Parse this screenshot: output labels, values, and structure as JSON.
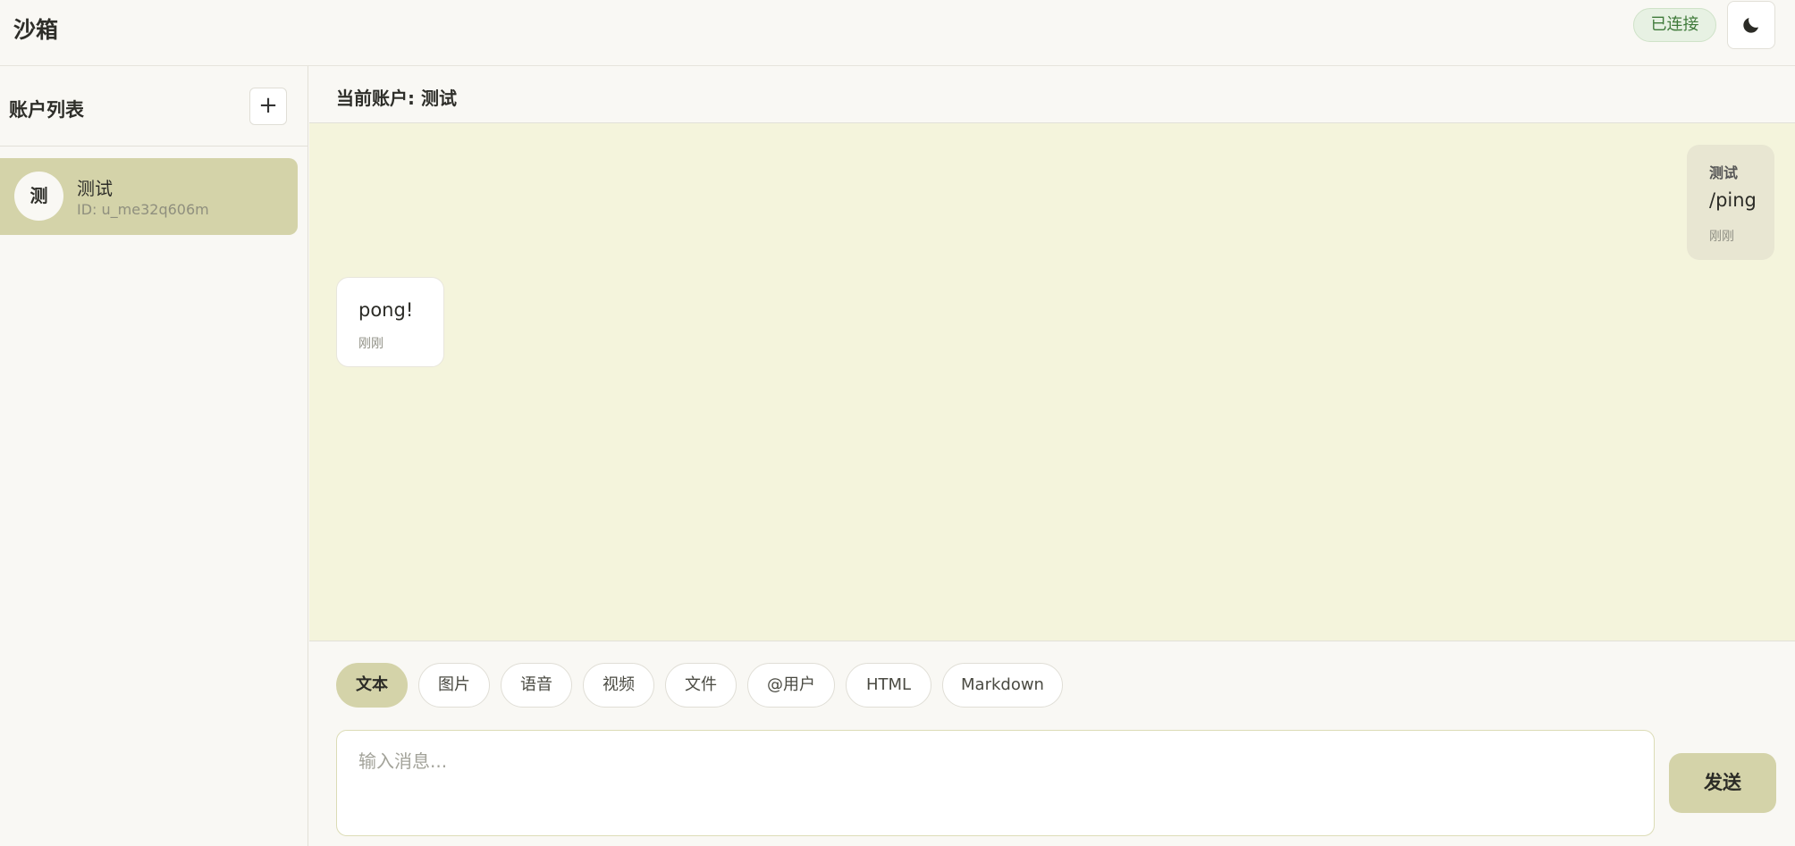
{
  "app": {
    "title": "沙箱"
  },
  "header": {
    "status": "已连接",
    "theme_icon": "moon-icon"
  },
  "sidebar": {
    "title": "账户列表",
    "add_label": "+",
    "accounts": [
      {
        "avatar": "测",
        "name": "测试",
        "id": "ID: u_me32q606m",
        "selected": true
      }
    ]
  },
  "main": {
    "current_account": "当前账户: 测试",
    "messages": [
      {
        "direction": "outgoing",
        "sender": "测试",
        "text": "/ping",
        "time": "刚刚"
      },
      {
        "direction": "incoming",
        "text": "pong!",
        "time": "刚刚"
      }
    ]
  },
  "composer": {
    "types": [
      {
        "label": "文本",
        "active": true
      },
      {
        "label": "图片",
        "active": false
      },
      {
        "label": "语音",
        "active": false
      },
      {
        "label": "视频",
        "active": false
      },
      {
        "label": "文件",
        "active": false
      },
      {
        "label": "@用户",
        "active": false
      },
      {
        "label": "HTML",
        "active": false
      },
      {
        "label": "Markdown",
        "active": false
      }
    ],
    "input_placeholder": "输入消息...",
    "send_label": "发送"
  },
  "colors": {
    "accent": "#d4d3a9",
    "chat_background": "#f4f4dc",
    "status_green": "#3f7a3a"
  }
}
